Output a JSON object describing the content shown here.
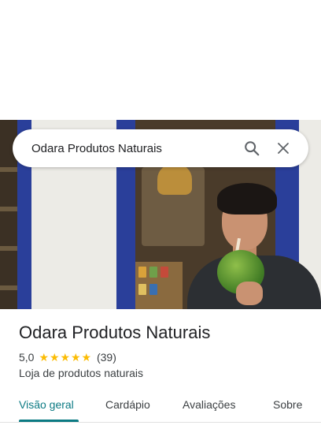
{
  "search": {
    "query": "Odara Produtos Naturais",
    "search_icon": "search-icon",
    "close_icon": "close-icon"
  },
  "place": {
    "name": "Odara Produtos Naturais",
    "rating": "5,0",
    "stars": 5,
    "review_count": "(39)",
    "category": "Loja de produtos naturais"
  },
  "tabs": [
    {
      "label": "Visão geral",
      "active": true
    },
    {
      "label": "Cardápio",
      "active": false
    },
    {
      "label": "Avaliações",
      "active": false
    },
    {
      "label": "Sobre",
      "active": false
    }
  ],
  "colors": {
    "accent": "#0b7a83",
    "star": "#fbbc04",
    "door_frame": "#2a3f9a"
  }
}
